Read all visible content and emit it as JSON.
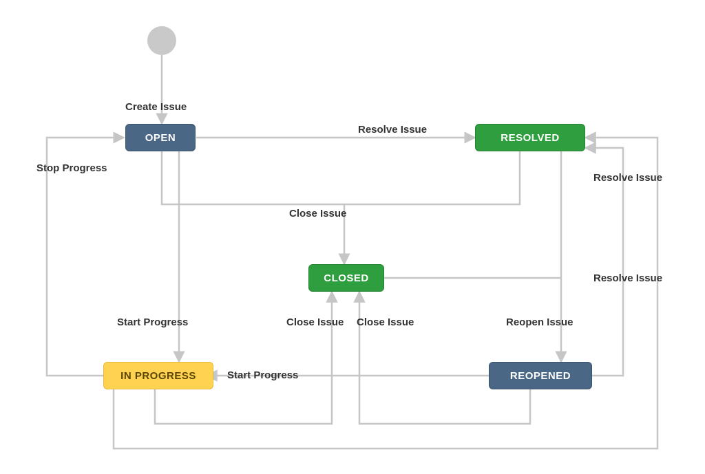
{
  "states": {
    "open": "OPEN",
    "resolved": "RESOLVED",
    "closed": "CLOSED",
    "in_progress": "IN PROGRESS",
    "reopened": "REOPENED"
  },
  "transitions": {
    "create_issue": "Create Issue",
    "resolve_issue_1": "Resolve Issue",
    "resolve_issue_2": "Resolve Issue",
    "resolve_issue_3": "Resolve Issue",
    "stop_progress": "Stop Progress",
    "start_progress_1": "Start Progress",
    "start_progress_2": "Start Progress",
    "close_issue_top": "Close Issue",
    "close_issue_left": "Close Issue",
    "close_issue_right": "Close Issue",
    "reopen_issue": "Reopen Issue"
  },
  "colors": {
    "blue": "#4a6785",
    "green": "#2e9e3f",
    "yellow": "#ffd351",
    "line": "#cfcfcf",
    "text": "#333333"
  }
}
